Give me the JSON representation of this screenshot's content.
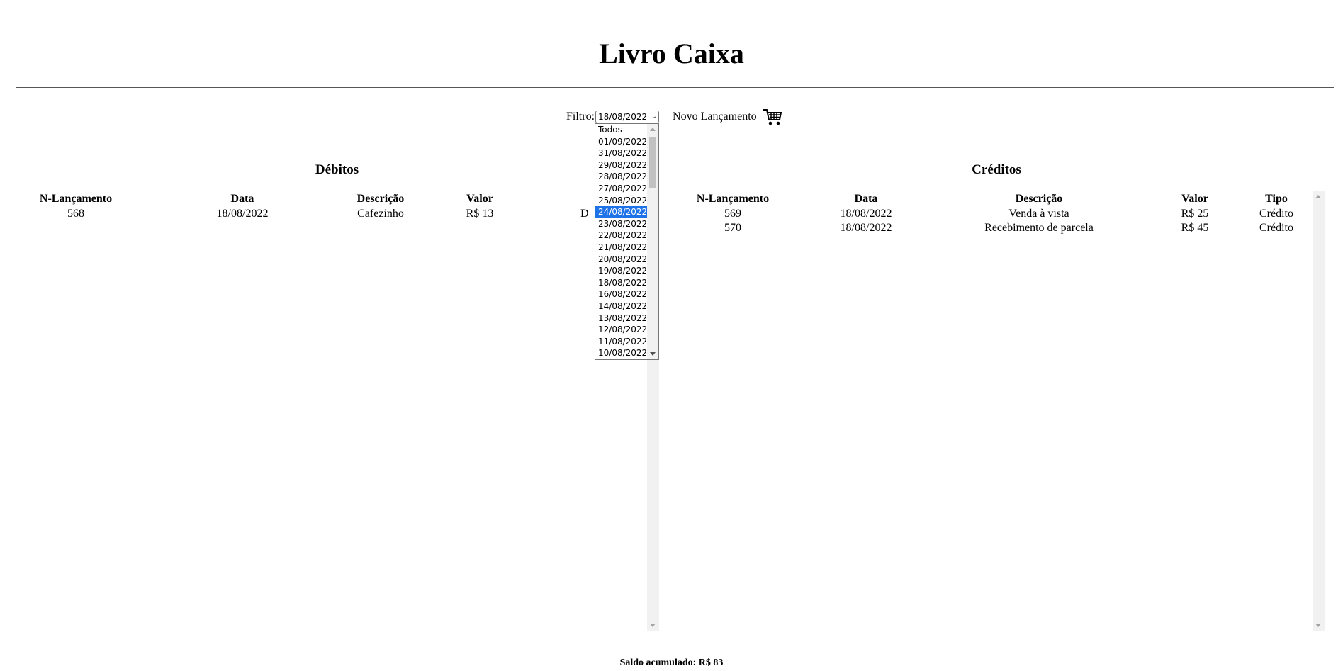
{
  "page": {
    "title": "Livro Caixa"
  },
  "filter": {
    "label": "Filtro:",
    "selected": "18/08/2022",
    "highlighted": "24/08/2022",
    "options": [
      "Todos",
      "01/09/2022",
      "31/08/2022",
      "29/08/2022",
      "28/08/2022",
      "27/08/2022",
      "25/08/2022",
      "24/08/2022",
      "23/08/2022",
      "22/08/2022",
      "21/08/2022",
      "20/08/2022",
      "19/08/2022",
      "18/08/2022",
      "16/08/2022",
      "14/08/2022",
      "13/08/2022",
      "12/08/2022",
      "11/08/2022",
      "10/08/2022"
    ]
  },
  "novo_lancamento": {
    "label": "Novo Lançamento",
    "icon": "shopping-cart-icon"
  },
  "debitos": {
    "title": "Débitos",
    "headers": [
      "N-Lançamento",
      "Data",
      "Descrição",
      "Valor"
    ],
    "rows": [
      [
        "568",
        "18/08/2022",
        "Cafezinho",
        "R$ 13"
      ]
    ],
    "partial_cell": "D"
  },
  "creditos": {
    "title": "Créditos",
    "headers": [
      "N-Lançamento",
      "Data",
      "Descrição",
      "Valor",
      "Tipo"
    ],
    "rows": [
      [
        "569",
        "18/08/2022",
        "Venda à vista",
        "R$ 25",
        "Crédito"
      ],
      [
        "570",
        "18/08/2022",
        "Recebimento de parcela",
        "R$ 45",
        "Crédito"
      ]
    ]
  },
  "saldo": {
    "text": "Saldo acumulado: R$ 83"
  },
  "colors": {
    "highlight": "#1e73e8",
    "scrollbar": "#f1f1f1"
  }
}
